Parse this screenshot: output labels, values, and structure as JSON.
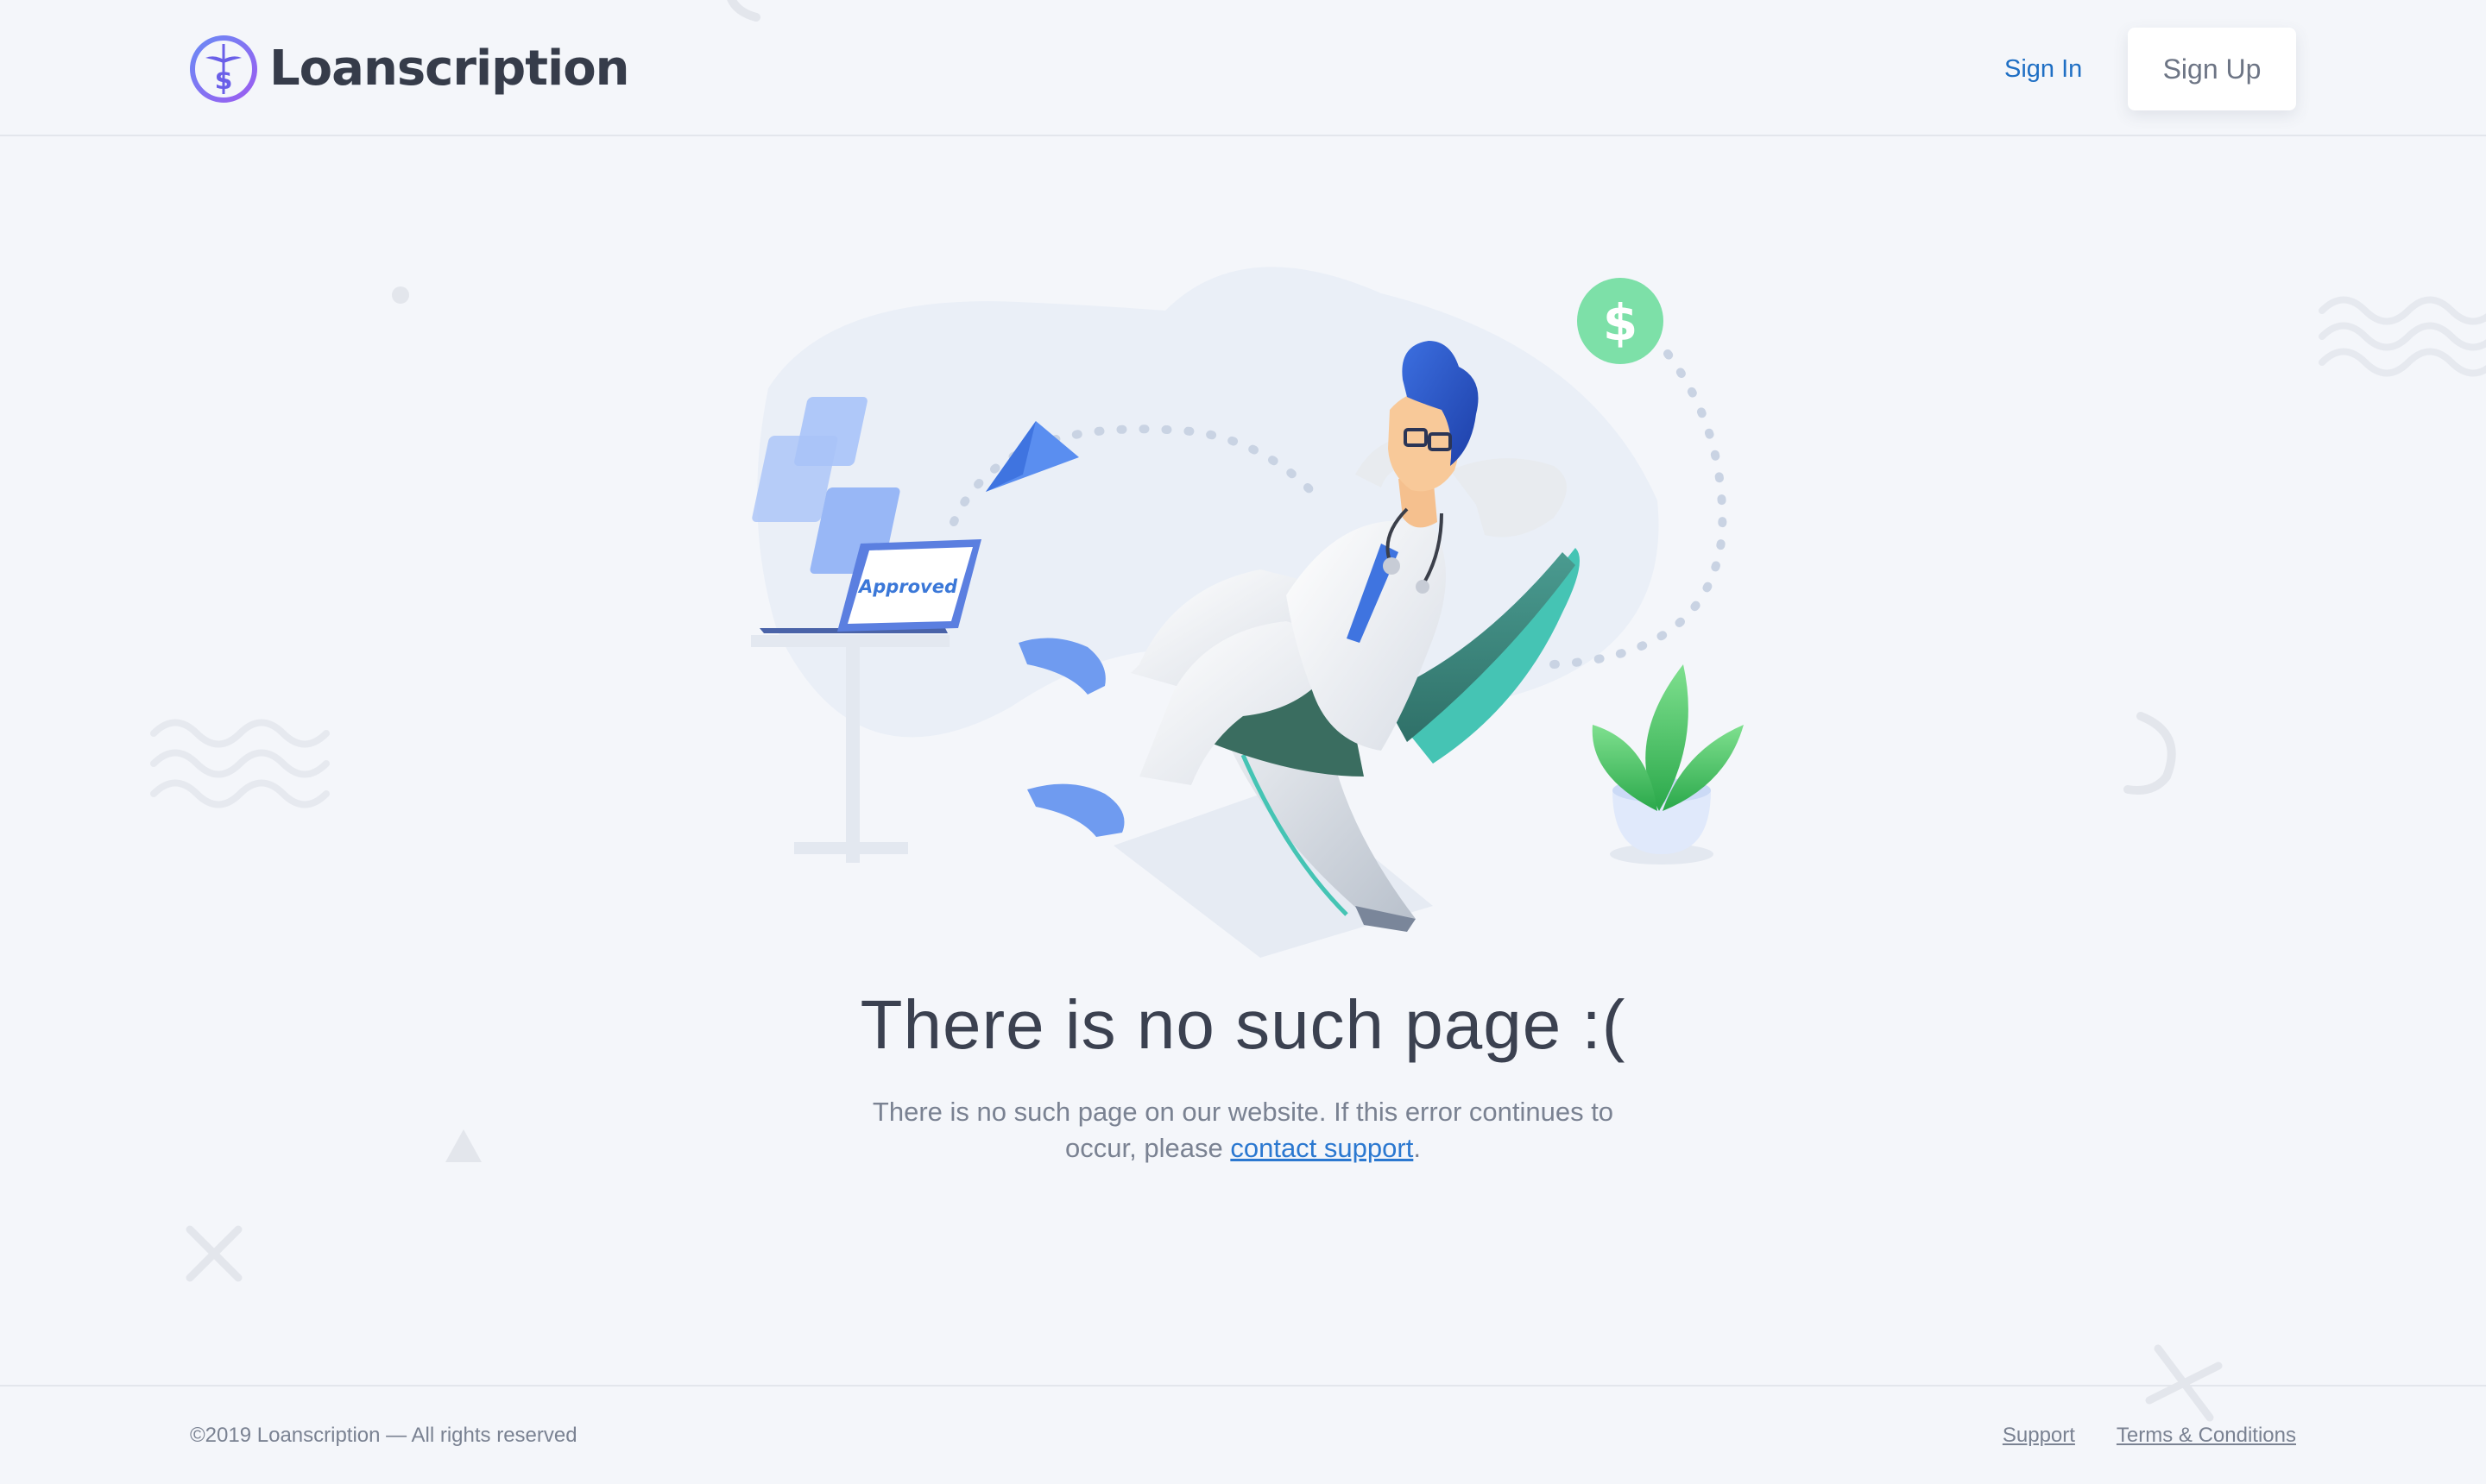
{
  "header": {
    "brand": "Loanscription",
    "sign_in_label": "Sign In",
    "sign_up_label": "Sign Up"
  },
  "illustration": {
    "laptop_screen_text": "Approved",
    "coin_symbol": "$"
  },
  "main": {
    "title": "There is no such page :(",
    "message_before": "There is no such page on our website. If this error continues to occur, please ",
    "message_link": "contact support",
    "message_after": "."
  },
  "footer": {
    "copyright": "©2019 Loanscription — All rights reserved",
    "links": [
      "Support",
      "Terms & Conditions"
    ]
  },
  "colors": {
    "background": "#f4f6fa",
    "link_blue": "#1f6fc4",
    "logo_purple": "#7b6cf0",
    "text_dark": "#3b4150",
    "text_muted": "#7a8292"
  }
}
